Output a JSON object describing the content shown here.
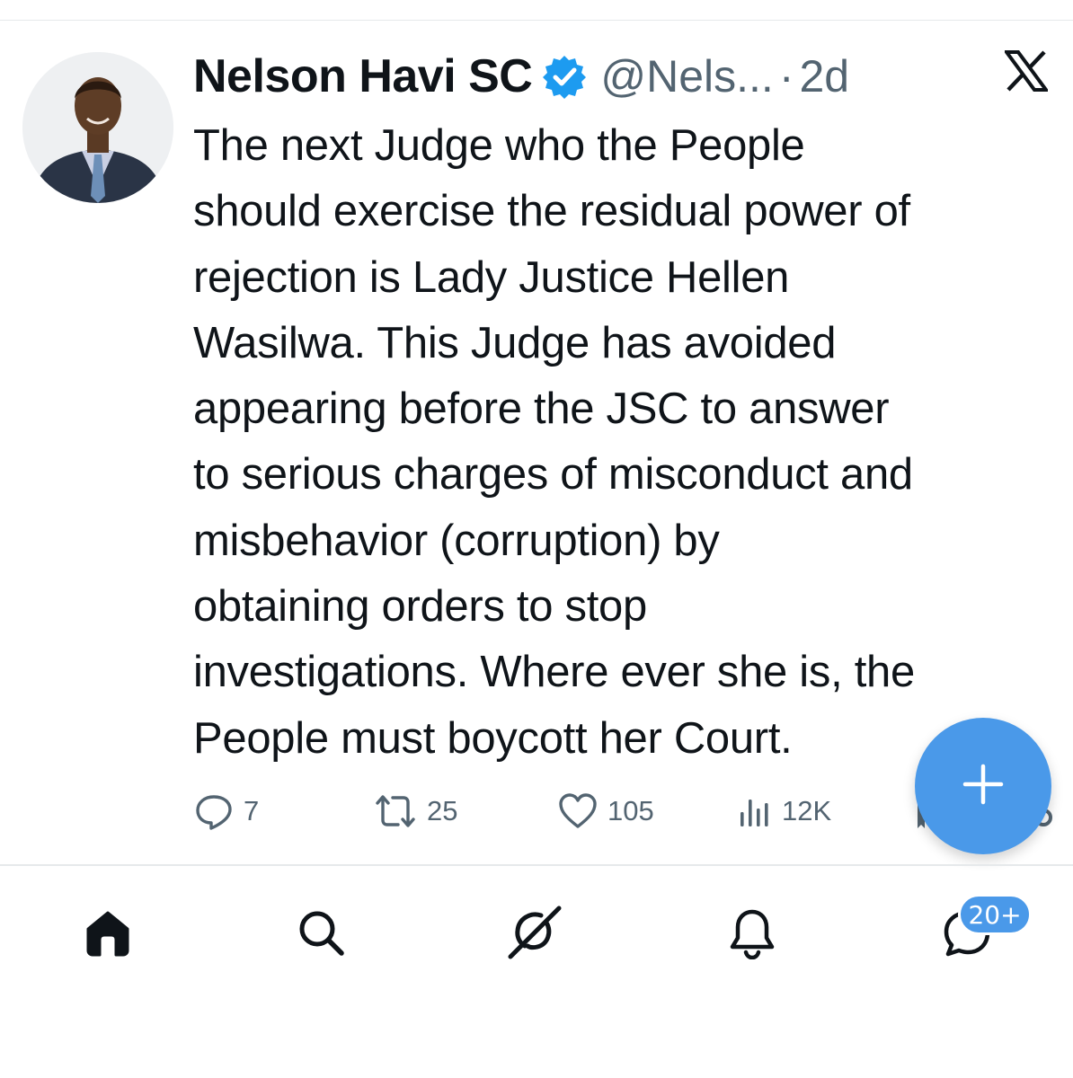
{
  "tweet": {
    "author_name": "Nelson Havi SC",
    "handle": "@Nels...",
    "separator": "·",
    "time": "2d",
    "lines": [
      "The next Judge who the People",
      "should exercise the residual power of",
      "rejection is Lady Justice Hellen",
      "Wasilwa. This Judge has avoided",
      "appearing before the JSC to answer",
      "to serious charges of misconduct and",
      "misbehavior (corruption) by",
      "obtaining orders to stop",
      "investigations. Where ever she is, the",
      "People must boycott her Court."
    ]
  },
  "actions": {
    "replies": "7",
    "reposts": "25",
    "likes": "105",
    "views": "12K"
  },
  "nav": {
    "items": [
      {
        "name": "home",
        "icon": "home-icon"
      },
      {
        "name": "search",
        "icon": "search-icon"
      },
      {
        "name": "grok",
        "icon": "grok-icon"
      },
      {
        "name": "notifications",
        "icon": "bell-icon"
      },
      {
        "name": "messages",
        "icon": "message-icon"
      }
    ],
    "messages_badge": "20+"
  },
  "colors": {
    "accent": "#4a99e9",
    "verified": "#1d9bf0",
    "text": "#0f1419",
    "muted": "#536471"
  }
}
